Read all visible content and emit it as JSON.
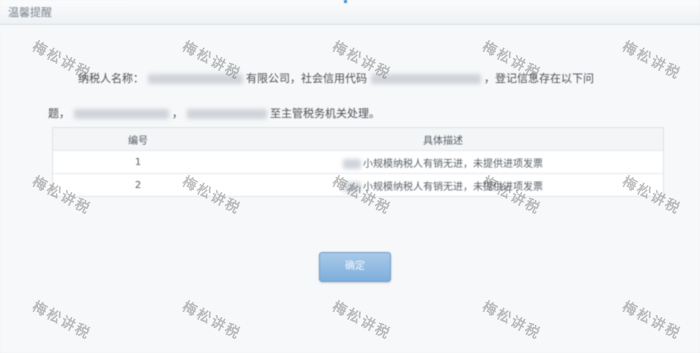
{
  "dialog": {
    "title": "温馨提醒",
    "message_prefix": "纳税人名称：",
    "message_mid1": "有限公司，社会信用代码",
    "message_mid2": "，登记信息存在以下问",
    "message_line2_a": "题，",
    "message_line2_b": "，",
    "message_line2_c": "至主管税务机关处理。",
    "table": {
      "headers": [
        "编号",
        "具体描述"
      ],
      "rows": [
        {
          "no": "1",
          "desc": "小规模纳税人有销无进，未提供进项发票"
        },
        {
          "no": "2",
          "desc": "小规模纳税人有销无进，未提供进项发票"
        }
      ]
    },
    "ok_button": "确定"
  },
  "watermark": "梅松讲税"
}
